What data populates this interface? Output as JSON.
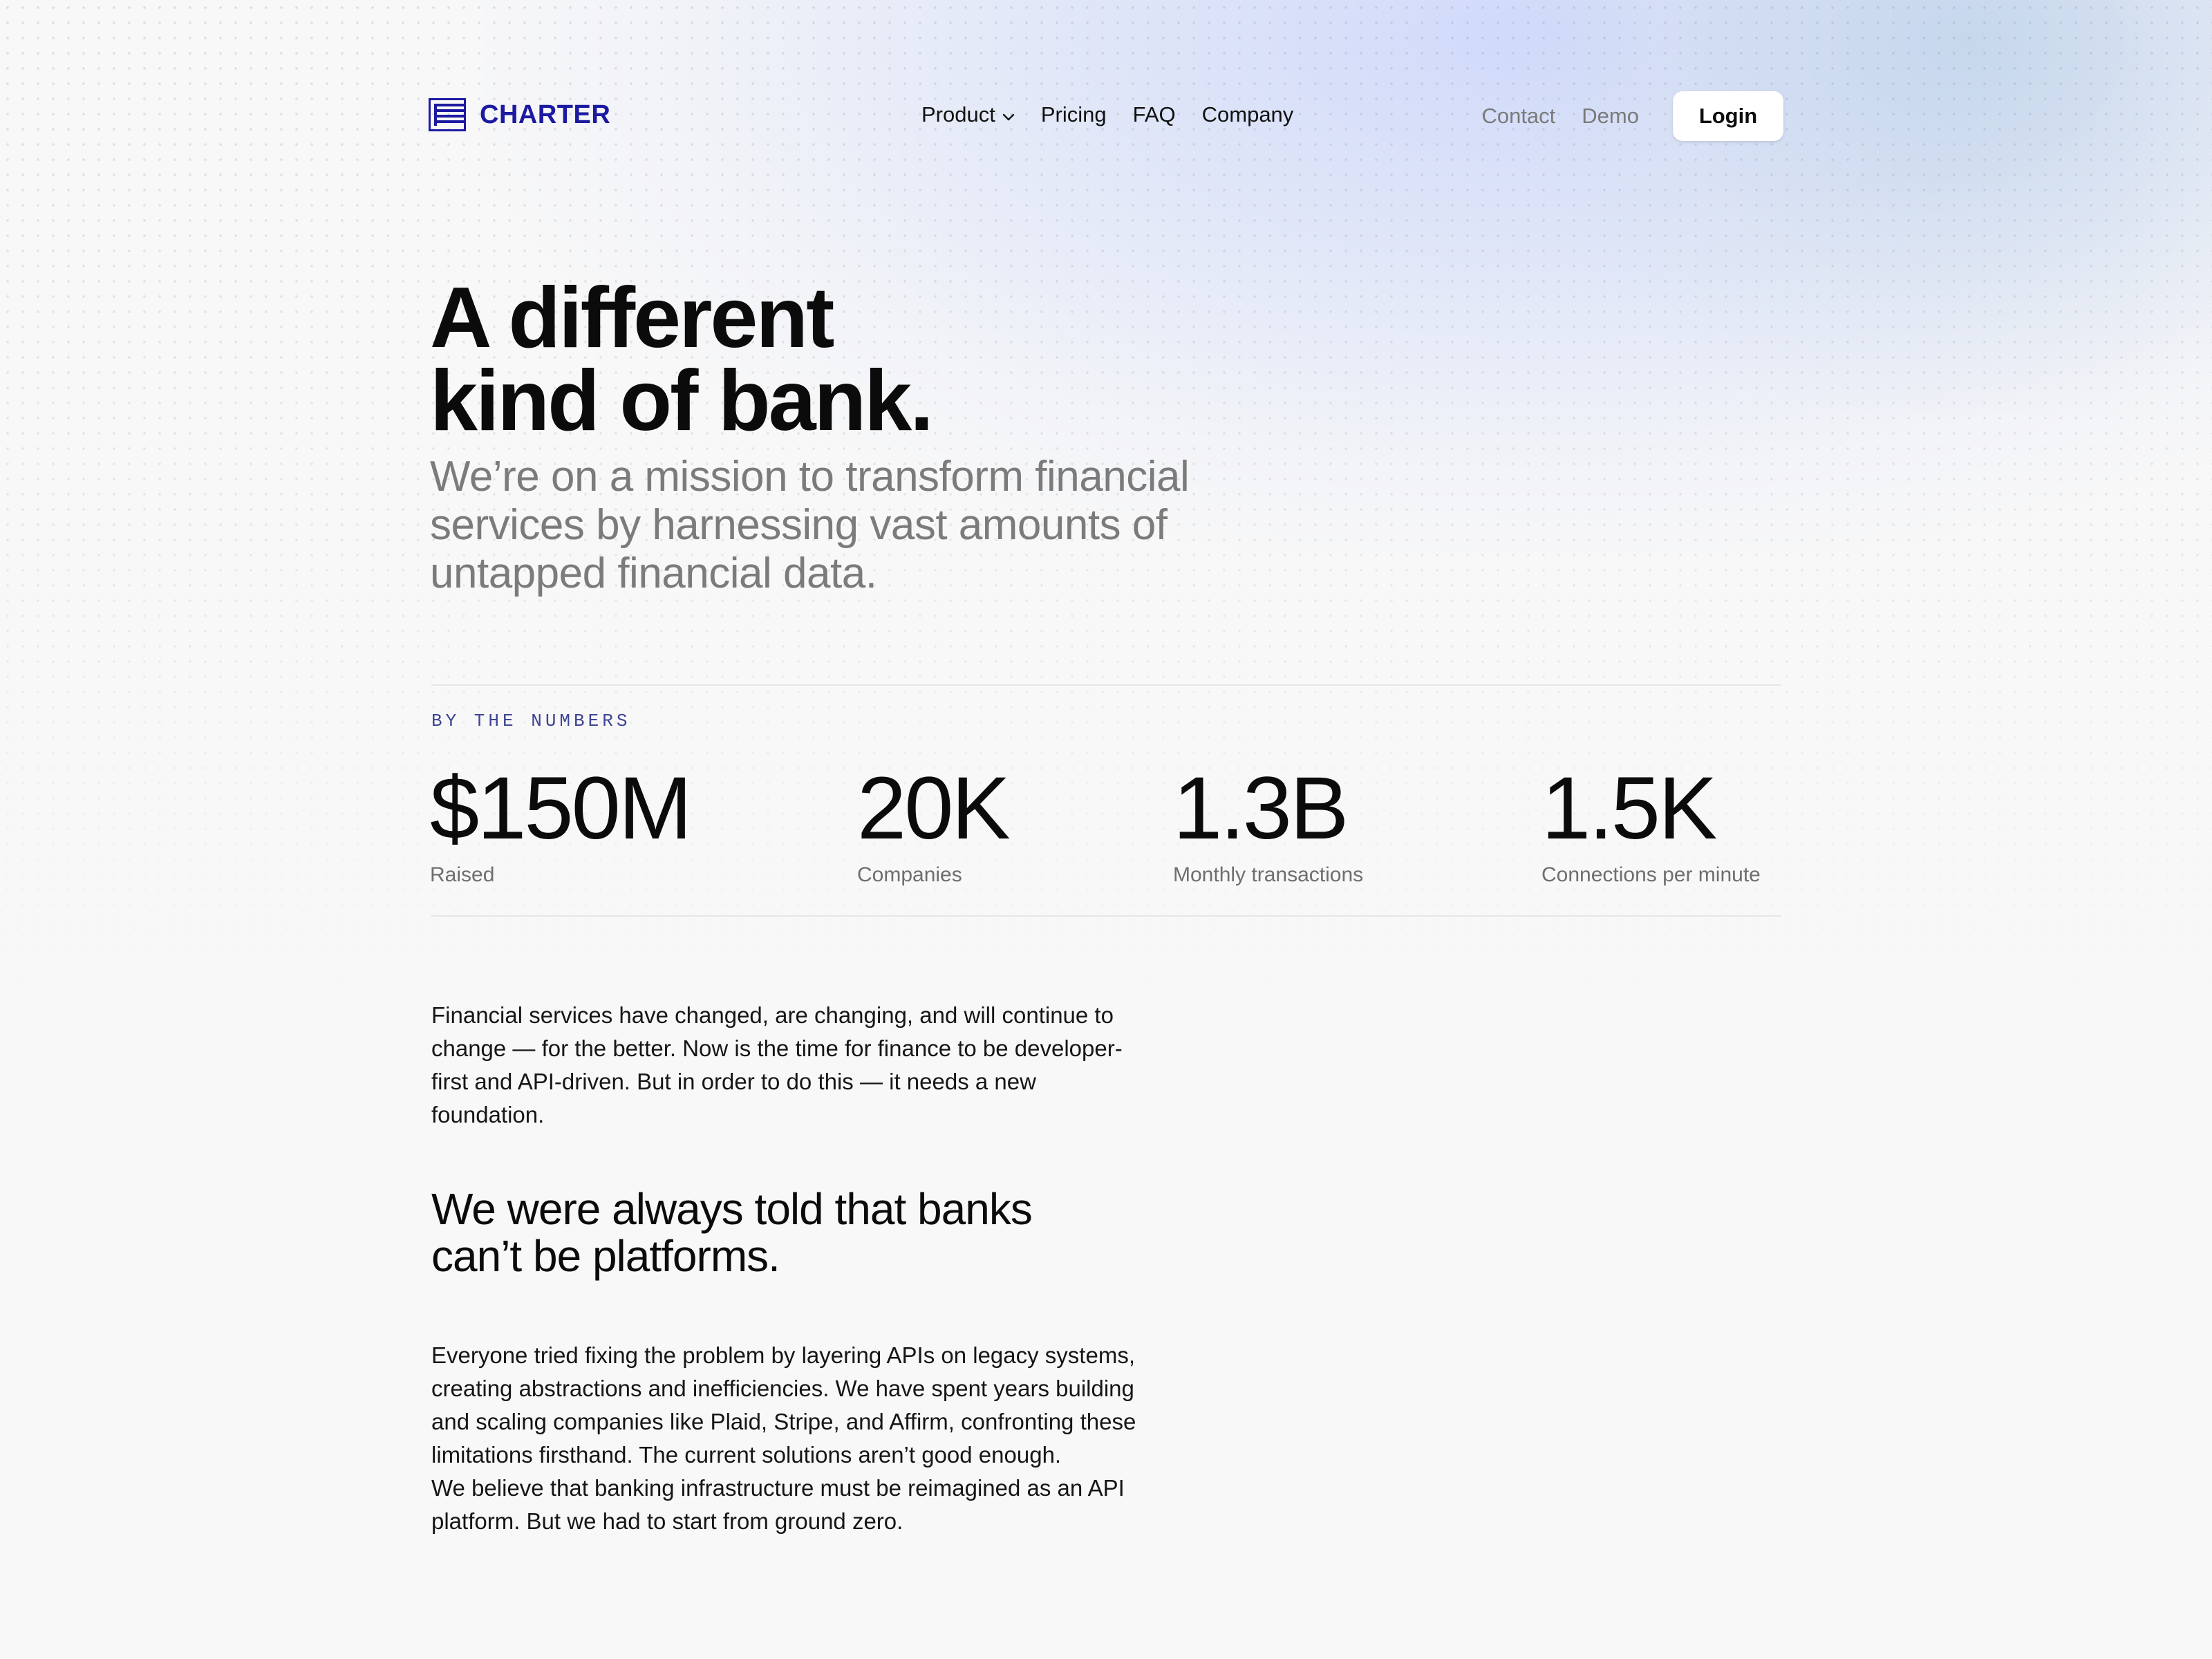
{
  "brand": {
    "name": "CHARTER",
    "color": "#1c1aa0"
  },
  "nav": {
    "items": [
      {
        "label": "Product",
        "has_dropdown": true
      },
      {
        "label": "Pricing"
      },
      {
        "label": "FAQ"
      },
      {
        "label": "Company"
      }
    ],
    "secondary": [
      {
        "label": "Contact"
      },
      {
        "label": "Demo"
      }
    ],
    "login_label": "Login"
  },
  "hero": {
    "title_line1": "A different",
    "title_line2": "kind of bank.",
    "subtitle_line1": "We’re on a mission to transform financial",
    "subtitle_line2": "services by harnessing vast amounts of",
    "subtitle_line3": "untapped financial data."
  },
  "numbers": {
    "label": "BY THE NUMBERS",
    "stats": [
      {
        "value": "$150M",
        "label": "Raised"
      },
      {
        "value": "20K",
        "label": "Companies"
      },
      {
        "value": "1.3B",
        "label": "Monthly transactions"
      },
      {
        "value": "1.5K",
        "label": "Connections per minute"
      }
    ]
  },
  "content": {
    "intro_lines": [
      "Financial services have changed, are changing, and will continue to",
      "change — for the better. Now is the time for finance to be developer-",
      "first and API-driven. But in order to do this — it needs a new",
      "foundation."
    ],
    "heading_line1": "We were always told that banks",
    "heading_line2": "can’t be platforms.",
    "body_lines": [
      "Everyone tried fixing the problem by layering APIs on legacy systems,",
      "creating abstractions and inefficiencies. We have spent years building",
      "and scaling companies like Plaid, Stripe, and Affirm, confronting these",
      "limitations firsthand. The current solutions aren’t good enough.",
      "We believe that banking infrastructure must be reimagined as an API",
      "platform. But we had to start from ground zero."
    ]
  }
}
